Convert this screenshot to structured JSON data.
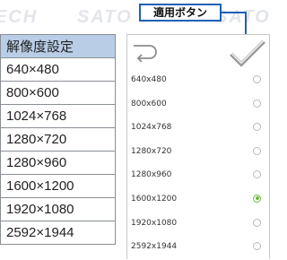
{
  "callout": {
    "label": "適用ボタン"
  },
  "resolution_table": {
    "header": "解像度設定",
    "rows": [
      "640×480",
      "800×600",
      "1024×768",
      "1280×720",
      "1280×960",
      "1600×1200",
      "1920×1080",
      "2592×1944"
    ]
  },
  "panel": {
    "back_icon": "back-arrow-icon",
    "apply_icon": "checkmark-icon",
    "options": [
      "640x480",
      "800x600",
      "1024x768",
      "1280x720",
      "1280x960",
      "1600x1200",
      "1920x1080",
      "2592x1944"
    ],
    "selected": "1600x1200",
    "accent_color": "#6dbb3a",
    "callout_color": "#1f5fb7"
  }
}
